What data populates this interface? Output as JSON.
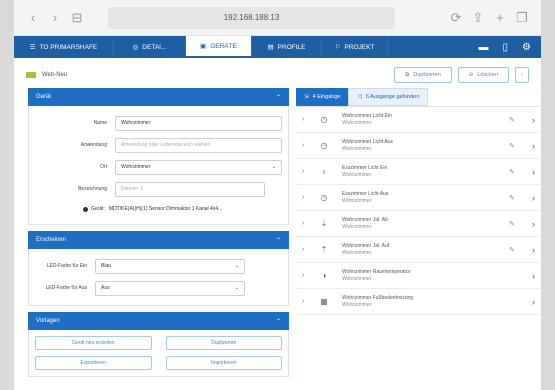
{
  "browser": {
    "back": "‹",
    "forward": "›",
    "book": "⊟",
    "url": "192.168.188.13",
    "reload": "⟳",
    "share": "⇪",
    "add": "+",
    "tabs": "❐"
  },
  "nav": {
    "items": [
      {
        "label": "TO PRIMARSHAFE",
        "icon": "☰"
      },
      {
        "label": "DETAI...",
        "icon": "◎"
      },
      {
        "label": "GERÄTE",
        "icon": "▣"
      },
      {
        "label": "PROFILE",
        "icon": "▤"
      },
      {
        "label": "PROJEKT",
        "icon": "⚐"
      }
    ],
    "icons": [
      "▬",
      "▯",
      "⚙"
    ]
  },
  "subhead": {
    "title": "Web-Neu",
    "actions": [
      {
        "label": "Duplizieren",
        "icon": "⧉"
      },
      {
        "label": "Löschen",
        "icon": "⊖"
      }
    ],
    "more": "›"
  },
  "geraet": {
    "title": "Gerät",
    "name_label": "Name",
    "name_value": "Wohnzimmer",
    "anwendung_label": "Anwendung",
    "anwendung_placeholder": "Anwendung oder Lebensbereich wählen",
    "ort_label": "Ort",
    "ort_value": "Wohnzimmer",
    "bezeichnung_label": "Bezeichnung",
    "bezeichnung_value": "Dimmer 1",
    "geraet_label": "Gerät:",
    "geraet_value": "MDT/KE(A)(H)(1) Sensor Dimmaktor 1 Kanal 4x4..."
  },
  "erscheinen": {
    "title": "Erscheinen",
    "led1_label": "LED-Farbe für Ein",
    "led1_value": "Blau",
    "led2_label": "LED-Farbe für Aus",
    "led2_value": "Aus"
  },
  "vorlagen": {
    "title": "Vorlagen",
    "buttons": [
      "Gerät neu erstellen",
      "Duplizieren",
      "Exportieren",
      "Importieren"
    ]
  },
  "right": {
    "tab1": "4 Eingänge",
    "tab2": "6 Ausgänge gefunden",
    "items": [
      {
        "title": "Wohnzimmer Licht Ein",
        "sub": "Wohnzimmer",
        "icon": "◷",
        "edit": true
      },
      {
        "title": "Wohnzimmer Licht Aus",
        "sub": "Wohnzimmer",
        "icon": "◷",
        "edit": true
      },
      {
        "title": "Esszimmer Licht Ein",
        "sub": "Wohnzimmer",
        "icon": "♁",
        "edit": true
      },
      {
        "title": "Esszimmer Licht Aus",
        "sub": "Wohnzimmer",
        "icon": "◷",
        "edit": true
      },
      {
        "title": "Wohnzimmer Jal. Ab",
        "sub": "Wohnzimmer",
        "icon": "⇣",
        "edit": true
      },
      {
        "title": "Wohnzimmer Jal. Auf",
        "sub": "Wohnzimmer",
        "icon": "⇡",
        "edit": true
      },
      {
        "title": "Wohnzimmer Raumtemperatur",
        "sub": "Wohnzimmer",
        "icon": "◑",
        "edit": false
      },
      {
        "title": "Wohnzimmer Fußbodenheizung",
        "sub": "Wohnzimmer",
        "icon": "▦",
        "edit": false
      }
    ]
  },
  "colors": {
    "primary": "#1e6fc4",
    "nav": "#1e5fa3",
    "accent_green": "#9bc53d"
  }
}
